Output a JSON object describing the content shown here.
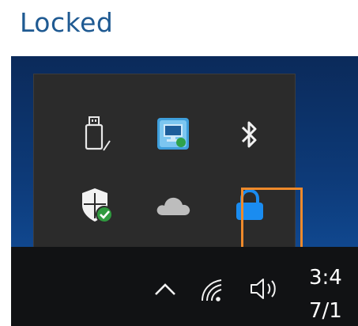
{
  "heading": "Locked",
  "tray": {
    "icons": [
      {
        "name": "usb-drive-icon"
      },
      {
        "name": "network-monitor-icon"
      },
      {
        "name": "bluetooth-icon"
      },
      {
        "name": "windows-security-icon"
      },
      {
        "name": "onedrive-cloud-icon"
      },
      {
        "name": "lock-icon",
        "highlighted": true
      }
    ]
  },
  "taskbar": {
    "clock_time": "3:4",
    "clock_date": "7/1"
  },
  "colors": {
    "heading": "#1f5a92",
    "highlight_border": "#ef8a2b",
    "lock_blue": "#1a8cf0",
    "flyout_bg": "#2b2b2b",
    "taskbar_bg": "#111214"
  }
}
